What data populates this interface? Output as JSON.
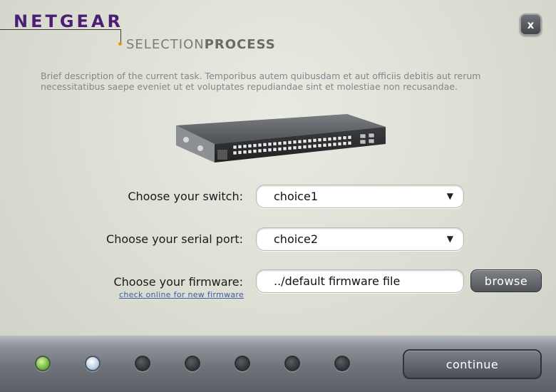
{
  "header": {
    "logo_text": "NETGEAR",
    "subtitle_light": "SELECTION",
    "subtitle_bold": "PROCESS",
    "close_label": "x"
  },
  "description": "Brief description of the current task. Temporibus autem quibusdam et aut officiis debitis aut rerum necessitatibus saepe eveniet ut et voluptates repudiandae sint et molestiae non recusandae.",
  "form": {
    "switch_label": "Choose your switch:",
    "switch_value": "choice1",
    "port_label": "Choose your serial port:",
    "port_value": "choice2",
    "firmware_label": "Choose your firmware:",
    "firmware_value": "../default firmware file",
    "firmware_link": "check online for new firmware",
    "browse_label": "browse",
    "dropdown_arrow": "▼"
  },
  "footer": {
    "continue_label": "continue",
    "steps": [
      "complete",
      "current",
      "pending",
      "pending",
      "pending",
      "pending",
      "pending"
    ]
  },
  "colors": {
    "brand": "#4a1f74",
    "accent_dot": "#e09a1a",
    "link": "#3c5da0"
  }
}
